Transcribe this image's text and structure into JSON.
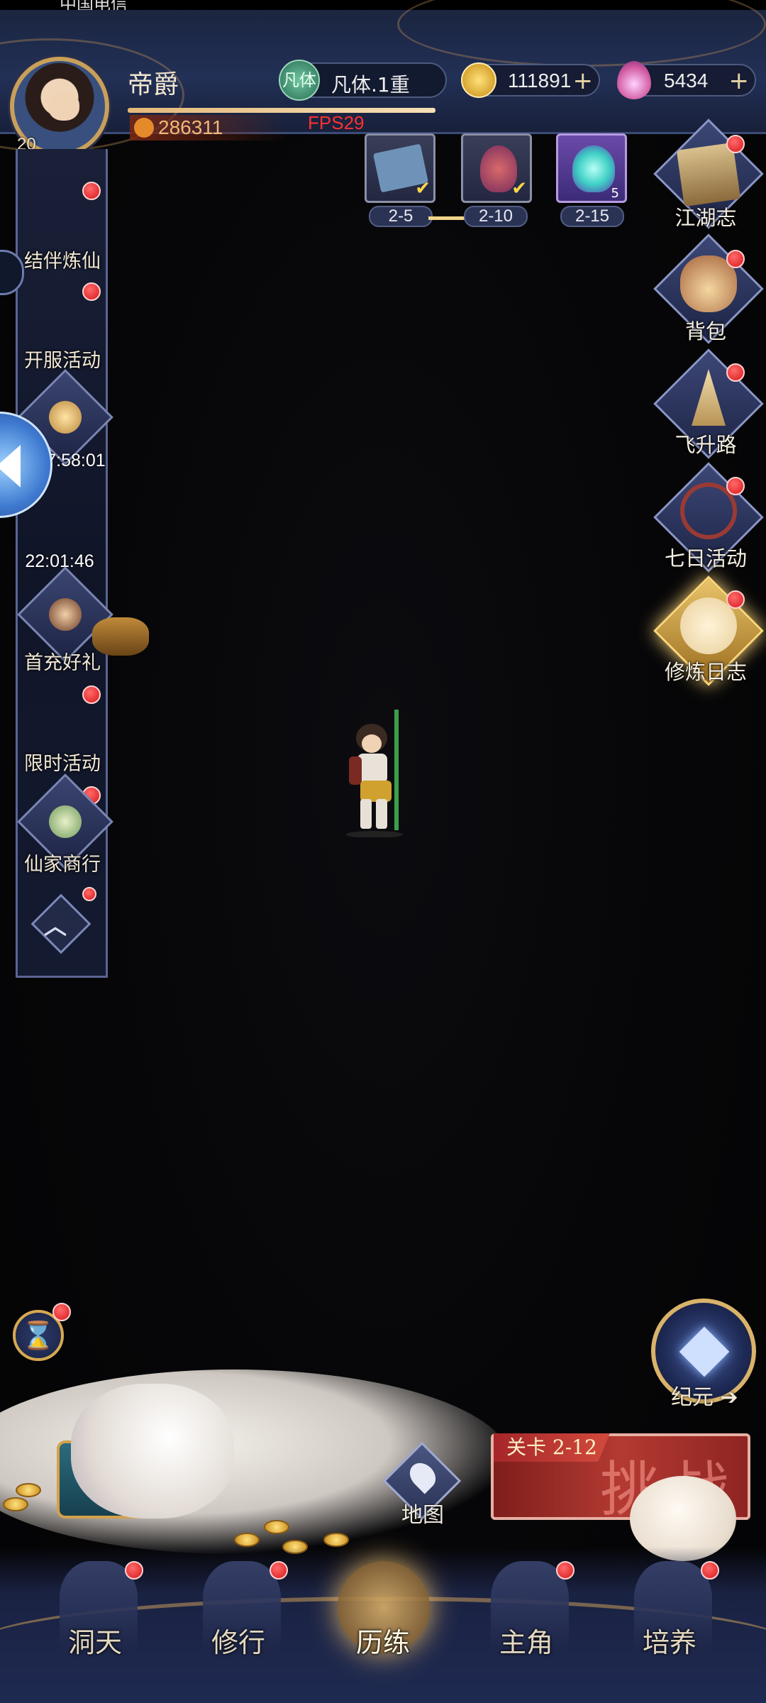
{
  "status_bar": {
    "carrier": "中国电信"
  },
  "player": {
    "name": "帝爵",
    "level": "20",
    "realm": "凡体.1重",
    "realm_badge": "凡体",
    "coins": "111891",
    "gems": "5434",
    "power": "286311",
    "exp_progress": 0.78
  },
  "debug": {
    "fps": "FPS29"
  },
  "stage_rewards": [
    {
      "label": "2-5",
      "claimed": true
    },
    {
      "label": "2-10",
      "claimed": true
    },
    {
      "label": "2-15",
      "claimed": false,
      "count": "5"
    }
  ],
  "left_menu": {
    "items": [
      {
        "label": "结伴炼仙"
      },
      {
        "label": "开服活动"
      },
      {
        "timer": "07:58:01"
      },
      {
        "timer": "22:01:46"
      },
      {
        "label": "首充好礼"
      },
      {
        "label": "限时活动"
      },
      {
        "label": "仙家商行"
      }
    ]
  },
  "right_menu": [
    {
      "label": "江湖志",
      "icon": "scroll-book-icon"
    },
    {
      "label": "背包",
      "icon": "bag-icon"
    },
    {
      "label": "飞升路",
      "icon": "stairs-icon"
    },
    {
      "label": "七日活动",
      "icon": "compass-icon"
    },
    {
      "label": "修炼日志",
      "icon": "beast-icon"
    }
  ],
  "bottom": {
    "era_label": "纪元",
    "map_label": "地图",
    "challenge": {
      "stage_tag": "关卡 2-12",
      "text": "挑战"
    }
  },
  "nav": [
    {
      "label": "洞天"
    },
    {
      "label": "修行"
    },
    {
      "label": "历练",
      "active": true
    },
    {
      "label": "主角"
    },
    {
      "label": "培养"
    }
  ],
  "colors": {
    "accent_gold": "#d7a950",
    "notify_red": "#d8171a",
    "fps_red": "#ff3030"
  }
}
